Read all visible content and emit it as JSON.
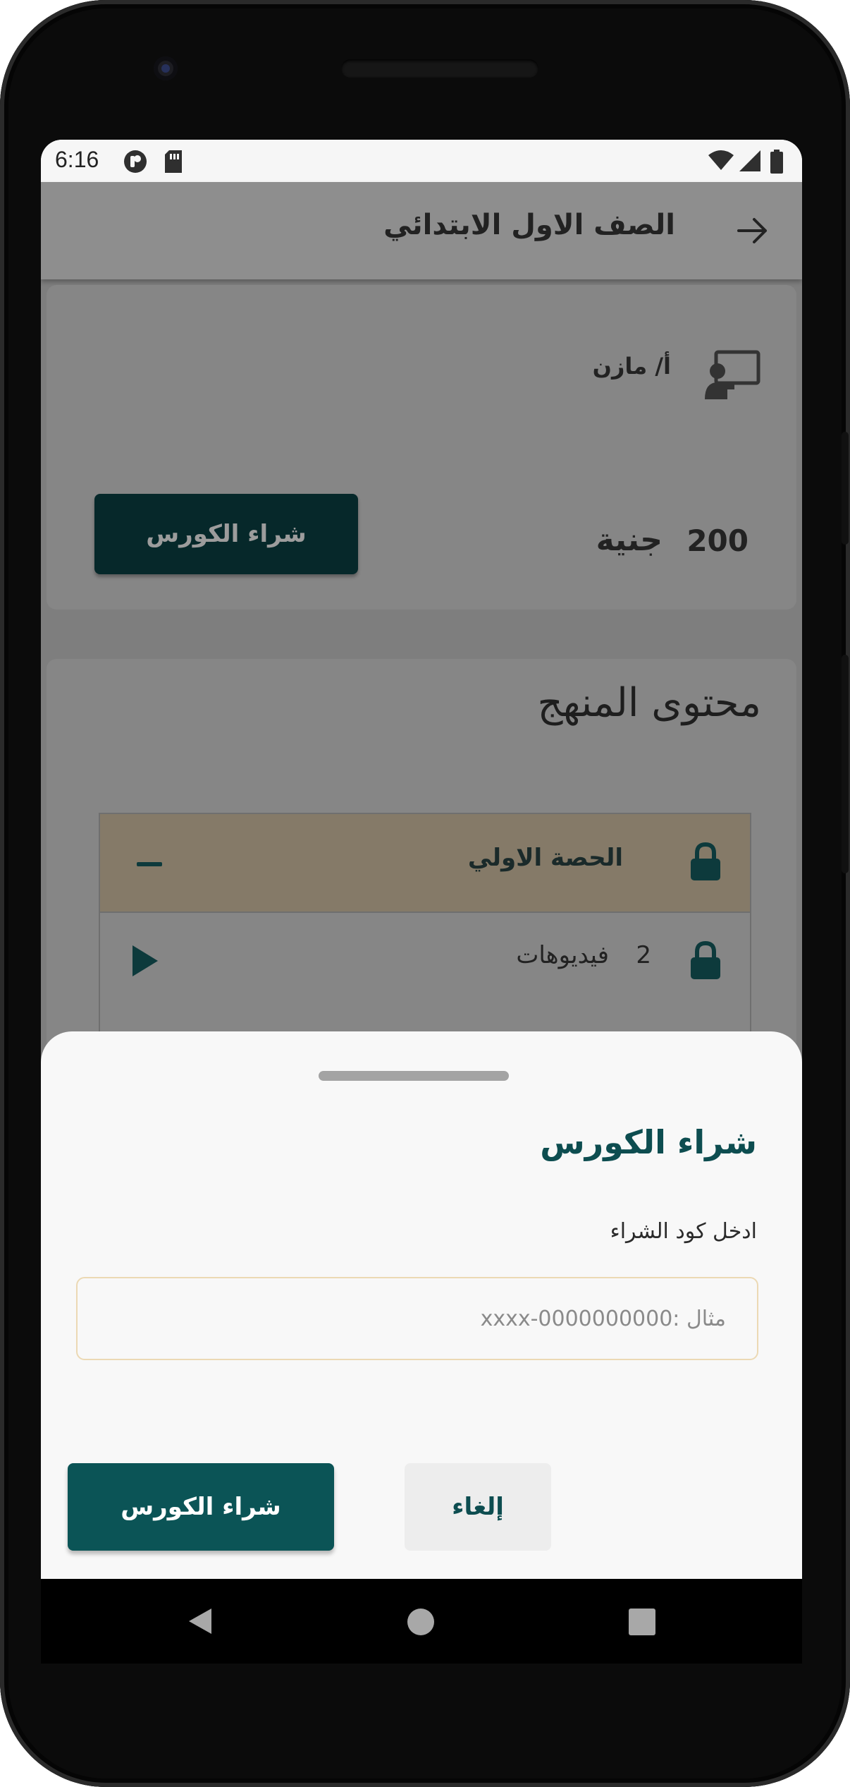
{
  "status_bar": {
    "time": "6:16",
    "left_icons": [
      "p-icon",
      "sd-card-icon"
    ],
    "right_icons": [
      "wifi-icon",
      "signal-icon",
      "battery-icon"
    ]
  },
  "app_bar": {
    "title": "الصف الاول الابتدائي",
    "back_icon": "arrow-back-icon"
  },
  "course_card": {
    "teacher_name": "أ/ مازن",
    "teacher_icon": "teacher-board-icon",
    "buy_button_label": "شراء الكورس",
    "price_value": "200",
    "price_currency": "جنية"
  },
  "curriculum": {
    "title": "محتوى المنهج",
    "lessons": [
      {
        "name": "الحصة الاولي",
        "locked": true,
        "expanded": true,
        "videos_count": "2",
        "videos_label": "فيديوهات"
      }
    ]
  },
  "bottom_sheet": {
    "title": "شراء الكورس",
    "code_label": "ادخل كود الشراء",
    "code_placeholder": "مثال :0000000000-xxxx",
    "code_value": "",
    "cancel_label": "إلغاء",
    "confirm_label": "شراء الكورس"
  },
  "colors": {
    "primary": "#0b5456",
    "lesson_header": "#857a68",
    "input_border": "#ecd9b4"
  }
}
